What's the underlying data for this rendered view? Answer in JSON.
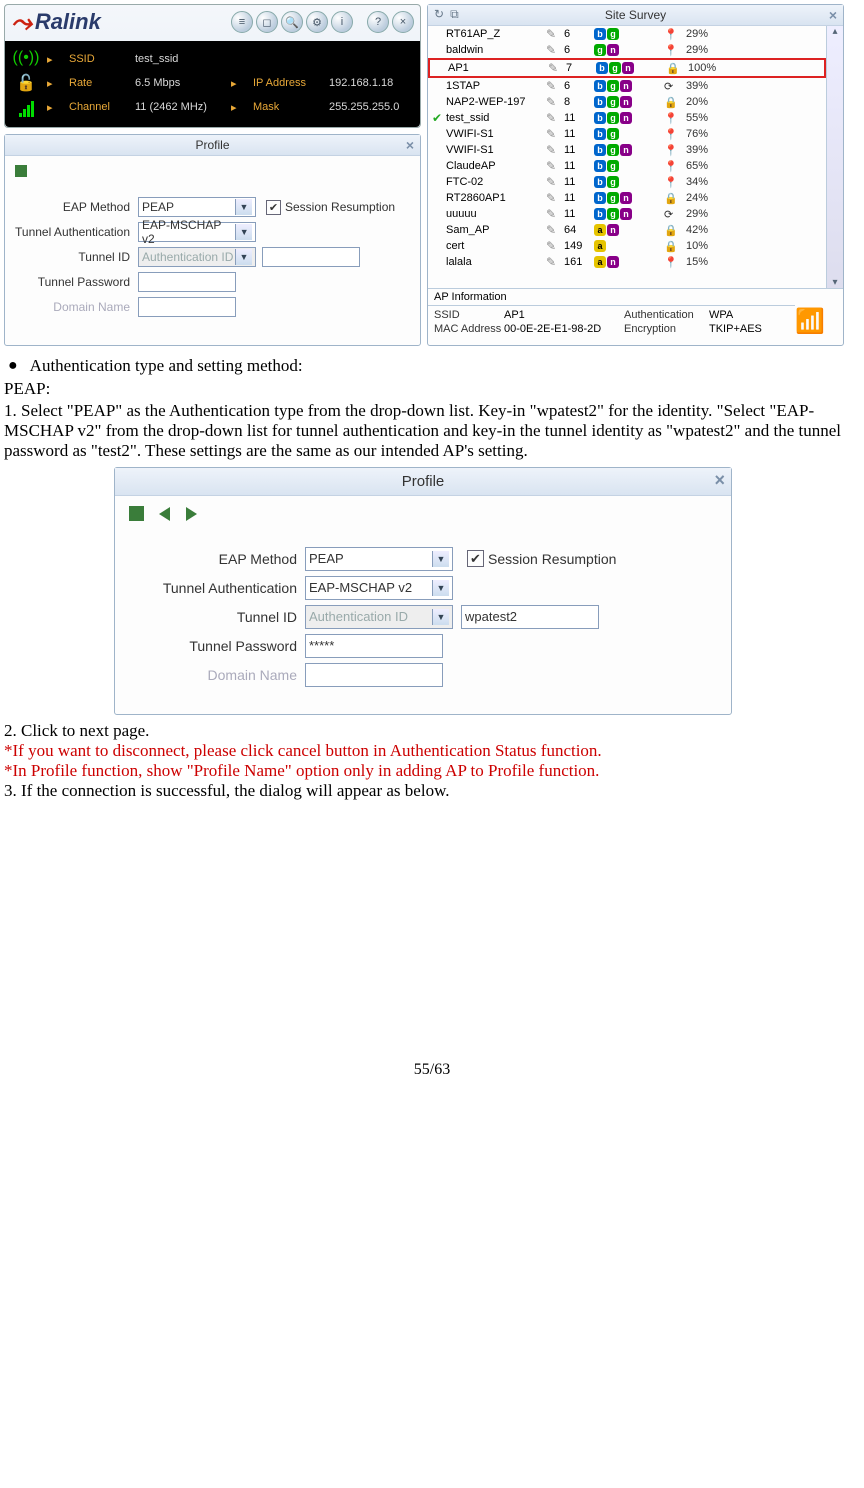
{
  "ralink": {
    "brand": "Ralink",
    "ssid_label": "SSID",
    "ssid": "test_ssid",
    "rate_label": "Rate",
    "rate": "6.5 Mbps",
    "channel_label": "Channel",
    "channel": "11 (2462 MHz)",
    "ip_label": "IP Address",
    "ip": "192.168.1.18",
    "mask_label": "Mask",
    "mask": "255.255.255.0"
  },
  "profile_small": {
    "title": "Profile",
    "eap_label": "EAP Method",
    "eap": "PEAP",
    "session_label": "Session Resumption",
    "tauth_label": "Tunnel Authentication",
    "tauth": "EAP-MSCHAP v2",
    "tid_label": "Tunnel ID",
    "tid_ph": "Authentication ID",
    "tid_val": "",
    "tpwd_label": "Tunnel Password",
    "tpwd_val": "",
    "domain_label": "Domain Name"
  },
  "survey": {
    "title": "Site Survey",
    "rows": [
      {
        "ssid": "RT61AP_Z",
        "ch": "6",
        "caps": [
          "b",
          "g"
        ],
        "sec": "",
        "sig": "29%",
        "sel": false,
        "tick": false
      },
      {
        "ssid": "baldwin",
        "ch": "6",
        "caps": [
          "g",
          "n"
        ],
        "sec": "",
        "sig": "29%",
        "sel": false,
        "tick": false
      },
      {
        "ssid": "AP1",
        "ch": "7",
        "caps": [
          "b",
          "g",
          "n"
        ],
        "sec": "lock",
        "sig": "100%",
        "sel": true,
        "tick": false
      },
      {
        "ssid": "1STAP",
        "ch": "6",
        "caps": [
          "b",
          "g",
          "n"
        ],
        "sec": "sec",
        "sig": "39%",
        "sel": false,
        "tick": false
      },
      {
        "ssid": "NAP2-WEP-197",
        "ch": "8",
        "caps": [
          "b",
          "g",
          "n"
        ],
        "sec": "lock",
        "sig": "20%",
        "sel": false,
        "tick": false
      },
      {
        "ssid": "test_ssid",
        "ch": "11",
        "caps": [
          "b",
          "g",
          "n"
        ],
        "sec": "",
        "sig": "55%",
        "sel": false,
        "tick": true
      },
      {
        "ssid": "VWIFI-S1",
        "ch": "11",
        "caps": [
          "b",
          "g"
        ],
        "sec": "",
        "sig": "76%",
        "sel": false,
        "tick": false
      },
      {
        "ssid": "VWIFI-S1",
        "ch": "11",
        "caps": [
          "b",
          "g",
          "n"
        ],
        "sec": "",
        "sig": "39%",
        "sel": false,
        "tick": false
      },
      {
        "ssid": "ClaudeAP",
        "ch": "11",
        "caps": [
          "b",
          "g"
        ],
        "sec": "",
        "sig": "65%",
        "sel": false,
        "tick": false
      },
      {
        "ssid": "FTC-02",
        "ch": "11",
        "caps": [
          "b",
          "g"
        ],
        "sec": "",
        "sig": "34%",
        "sel": false,
        "tick": false
      },
      {
        "ssid": "RT2860AP1",
        "ch": "11",
        "caps": [
          "b",
          "g",
          "n"
        ],
        "sec": "lock",
        "sig": "24%",
        "sel": false,
        "tick": false
      },
      {
        "ssid": "uuuuu",
        "ch": "11",
        "caps": [
          "b",
          "g",
          "n"
        ],
        "sec": "sec",
        "sig": "29%",
        "sel": false,
        "tick": false
      },
      {
        "ssid": "Sam_AP",
        "ch": "64",
        "caps": [
          "a",
          "n"
        ],
        "sec": "lock",
        "sig": "42%",
        "sel": false,
        "tick": false
      },
      {
        "ssid": "cert",
        "ch": "149",
        "caps": [
          "a"
        ],
        "sec": "lock",
        "sig": "10%",
        "sel": false,
        "tick": false
      },
      {
        "ssid": "lalala",
        "ch": "161",
        "caps": [
          "a",
          "n"
        ],
        "sec": "",
        "sig": "15%",
        "sel": false,
        "tick": false
      }
    ],
    "apinfo": {
      "header": "AP Information",
      "ssid_l": "SSID",
      "ssid": "AP1",
      "auth_l": "Authentication",
      "auth": "WPA",
      "mac_l": "MAC Address",
      "mac": "00-0E-2E-E1-98-2D",
      "enc_l": "Encryption",
      "enc": "TKIP+AES"
    }
  },
  "doc": {
    "bullet": "Authentication type and setting method:",
    "peap": "PEAP:",
    "step1": "1. Select \"PEAP\" as the Authentication type from the drop-down list. Key-in \"wpatest2\" for the identity. \"Select \"EAP-MSCHAP v2\" from the drop-down list for tunnel authentication and key-in the tunnel identity as \"wpatest2\" and the tunnel password as \"test2\". These settings are the same as our intended AP's setting.",
    "step2": "2. Click to next page.",
    "note1": "*If you want to disconnect, please click cancel button in Authentication Status function.",
    "note2": "*In Profile function, show \"Profile Name\" option only in adding AP to Profile function.",
    "step3": "3. If the connection is successful, the dialog will appear as below.",
    "pagenum": "55/63"
  },
  "profile_big": {
    "title": "Profile",
    "eap_label": "EAP Method",
    "eap": "PEAP",
    "session_label": "Session Resumption",
    "tauth_label": "Tunnel Authentication",
    "tauth": "EAP-MSCHAP v2",
    "tid_label": "Tunnel ID",
    "tid_ph": "Authentication ID",
    "tid_val": "wpatest2",
    "tpwd_label": "Tunnel Password",
    "tpwd_val": "*****",
    "domain_label": "Domain Name"
  }
}
